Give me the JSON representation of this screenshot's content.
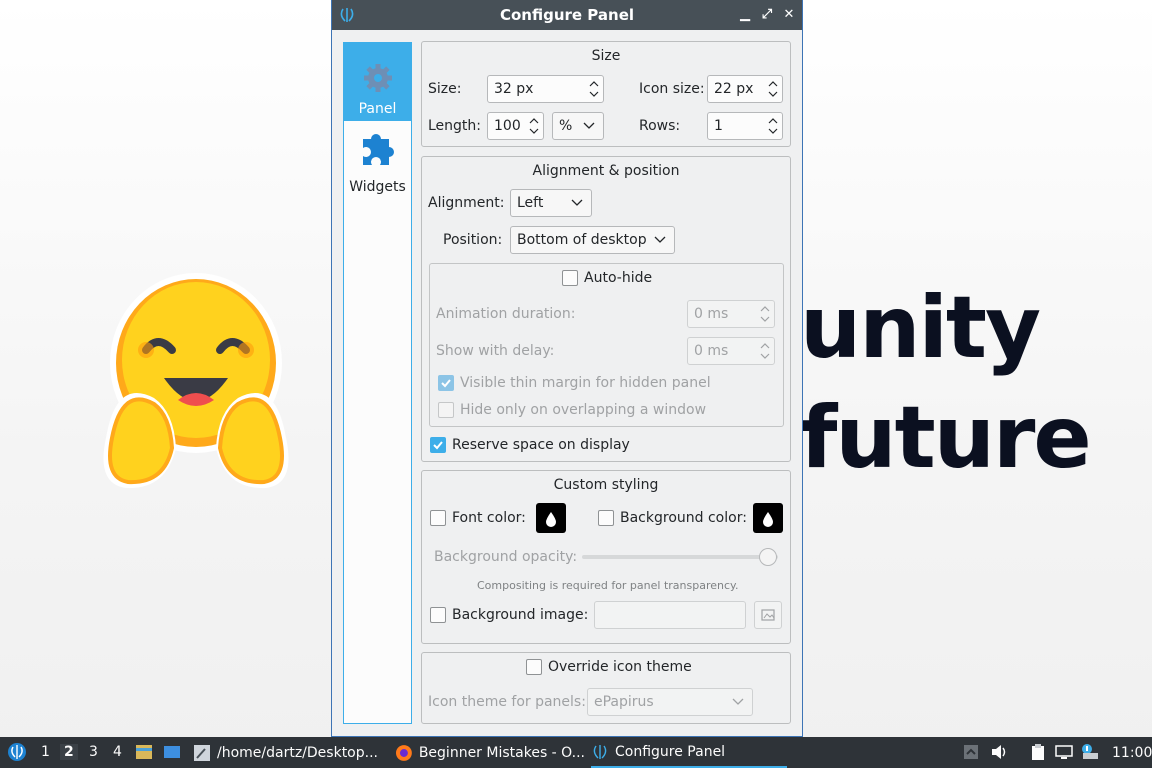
{
  "window": {
    "title": "Configure Panel",
    "controls": [
      "minimize",
      "maximize",
      "close"
    ]
  },
  "nav": {
    "items": [
      {
        "label": "Panel",
        "icon": "gear-icon",
        "active": true
      },
      {
        "label": "Widgets",
        "icon": "puzzle-icon",
        "active": false
      }
    ]
  },
  "size": {
    "title": "Size",
    "size_label": "Size:",
    "size_value": "32 px",
    "icon_size_label": "Icon size:",
    "icon_size_value": "22 px",
    "length_label": "Length:",
    "length_value": "100",
    "length_unit": "%",
    "rows_label": "Rows:",
    "rows_value": "1"
  },
  "alignment": {
    "title": "Alignment & position",
    "alignment_label": "Alignment:",
    "alignment_value": "Left",
    "position_label": "Position:",
    "position_value": "Bottom of desktop",
    "autohide_label": "Auto-hide",
    "autohide_checked": false,
    "animation_label": "Animation duration:",
    "animation_value": "0 ms",
    "delay_label": "Show with delay:",
    "delay_value": "0 ms",
    "thin_margin_label": "Visible thin margin for hidden panel",
    "thin_margin_checked": true,
    "overlap_label": "Hide only on overlapping a window",
    "overlap_checked": false,
    "reserve_label": "Reserve space on display",
    "reserve_checked": true
  },
  "styling": {
    "title": "Custom styling",
    "font_color_label": "Font color:",
    "bg_color_label": "Background color:",
    "font_color": "#000000",
    "bg_color": "#000000",
    "opacity_label": "Background opacity:",
    "opacity_value": 1.0,
    "compositing_note": "Compositing is required for panel transparency.",
    "bg_image_label": "Background image:",
    "bg_image_value": ""
  },
  "icon_theme": {
    "override_label": "Override icon theme",
    "theme_label": "Icon theme for panels:",
    "theme_value": "ePapirus"
  },
  "wallpaper": {
    "line1": "unity",
    "line2": "future"
  },
  "taskbar": {
    "workspaces": [
      "1",
      "2",
      "3",
      "4"
    ],
    "active_workspace": "2",
    "tasks": [
      {
        "label": "/home/dartz/Desktop...",
        "icon": "text-editor-icon"
      },
      {
        "label": "Beginner Mistakes - O...",
        "icon": "firefox-icon"
      },
      {
        "label": "Configure Panel",
        "icon": "panel-config-icon"
      }
    ],
    "clock": "11:00"
  }
}
